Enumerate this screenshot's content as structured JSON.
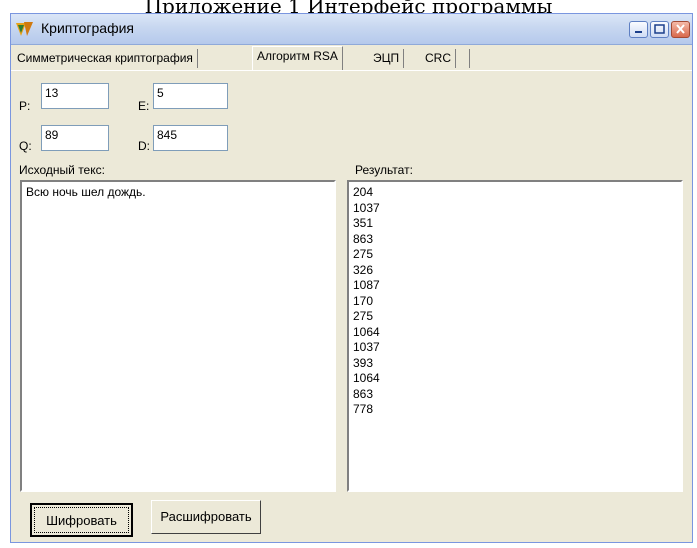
{
  "caption": "Приложение 1 Интерфейс программы",
  "window": {
    "title": "Криптография",
    "app_icon": "delphi-icon",
    "controls": [
      "minimize-icon",
      "maximize-icon",
      "close-icon"
    ]
  },
  "tabs": [
    {
      "label": "Симметрическая криптография",
      "active": false
    },
    {
      "label": "Алгоритм RSA",
      "active": true
    },
    {
      "label": "ЭЦП",
      "active": false
    },
    {
      "label": "CRC",
      "active": false
    }
  ],
  "params": {
    "p_label": "P:",
    "p_value": "13",
    "e_label": "E:",
    "e_value": "5",
    "q_label": "Q:",
    "q_value": "89",
    "d_label": "D:",
    "d_value": "845"
  },
  "source": {
    "label": "Исходный текс:",
    "text": "Всю ночь шел дождь."
  },
  "result": {
    "label": "Результат:",
    "lines": [
      "204",
      "1037",
      "351",
      "863",
      "275",
      "326",
      "1087",
      "170",
      "275",
      "1064",
      "1037",
      "393",
      "1064",
      "863",
      "778"
    ]
  },
  "buttons": {
    "encrypt": "Шифровать",
    "decrypt": "Расшифровать"
  }
}
